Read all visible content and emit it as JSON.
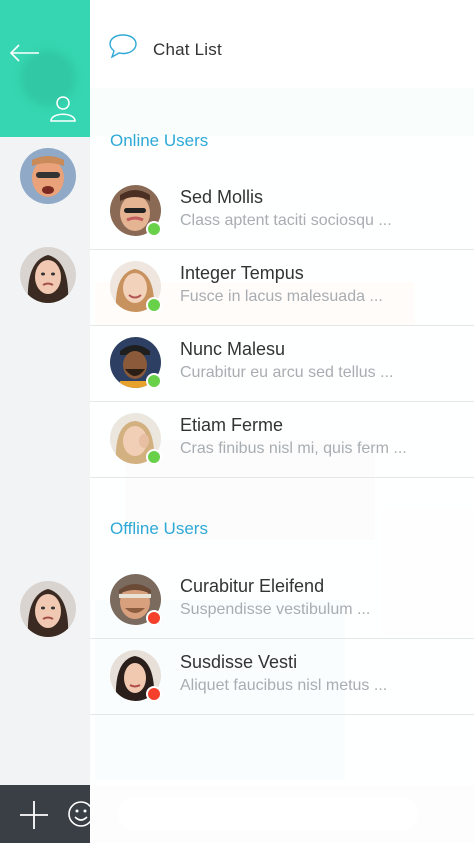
{
  "app": {
    "title": "Chat List"
  },
  "colors": {
    "accent": "#35d6b1",
    "link_blue": "#2ea9d6",
    "online": "#69d04a",
    "offline": "#f5402b",
    "footer": "#3a3f45"
  },
  "left": {
    "back_icon": "arrow-left-icon",
    "user_icon": "user-icon",
    "footer_add_icon": "plus-icon",
    "footer_emoji_icon": "smiley-icon"
  },
  "online_section": {
    "title": "Online Users",
    "users": [
      {
        "name": "Sed Mollis",
        "message": "Class aptent taciti sociosqu ...",
        "status": "online"
      },
      {
        "name": "Integer Tempus",
        "message": "Fusce in lacus malesuada ...",
        "status": "online"
      },
      {
        "name": "Nunc Malesu",
        "message": "Curabitur eu arcu sed tellus ...",
        "status": "online"
      },
      {
        "name": "Etiam Ferme",
        "message": "Cras finibus nisl mi, quis ferm ...",
        "status": "online"
      }
    ]
  },
  "offline_section": {
    "title": "Offline Users",
    "users": [
      {
        "name": "Curabitur Eleifend",
        "message": "Suspendisse vestibulum ...",
        "status": "offline"
      },
      {
        "name": "Susdisse Vesti",
        "message": "Aliquet faucibus nisl metus ...",
        "status": "offline"
      }
    ]
  }
}
